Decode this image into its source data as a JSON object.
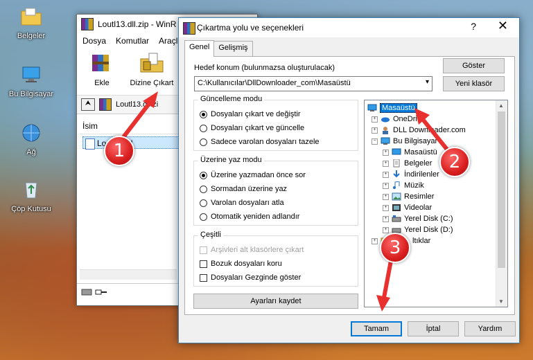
{
  "desktop": {
    "icons": [
      {
        "label": "Belgeler",
        "icon": "folder-icon"
      },
      {
        "label": "Bu Bilgisayar",
        "icon": "computer-icon"
      },
      {
        "label": "Ağ",
        "icon": "network-icon"
      },
      {
        "label": "Çöp Kutusu",
        "icon": "recycle-bin-icon"
      }
    ]
  },
  "winrar": {
    "title": "Loutl13.dll.zip - WinR",
    "menu": [
      "Dosya",
      "Komutlar",
      "Araçla"
    ],
    "toolbar": {
      "add_label": "Ekle",
      "extract_label": "Dizine Çıkart"
    },
    "path": "Loutl13.dll.zi",
    "list_header": "İsim",
    "file_name": "Lo.tl13.dll"
  },
  "dialog": {
    "title": "Çıkartma yolu ve seçenekleri",
    "help": "?",
    "close": "✕",
    "tabs": [
      "Genel",
      "Gelişmiş"
    ],
    "target_label": "Hedef konum (bulunmazsa oluşturulacak)",
    "target_value": "C:\\Kullanıcılar\\DllDownloader_com\\Masaüstü",
    "show_button": "Göster",
    "new_folder_button": "Yeni klasör",
    "update_group": {
      "label": "Güncelleme modu",
      "options": [
        "Dosyaları çıkart ve değiştir",
        "Dosyaları çıkart ve güncelle",
        "Sadece varolan dosyaları tazele"
      ],
      "selected": 0
    },
    "overwrite_group": {
      "label": "Üzerine yaz modu",
      "options": [
        "Üzerine yazmadan önce sor",
        "Sormadan üzerine yaz",
        "Varolan dosyaları atla",
        "Otomatik yeniden adlandır"
      ],
      "selected": 0
    },
    "misc_group": {
      "label": "Çeşitli",
      "options": [
        "Arşivleri alt klasörlere çıkart",
        "Bozuk dosyaları koru",
        "Dosyaları Gezginde göster"
      ]
    },
    "save_settings": "Ayarları kaydet",
    "tree": [
      {
        "label": "Masaüstü",
        "icon": "desktop-icon",
        "selected": true
      },
      {
        "label": "OneDrive",
        "icon": "onedrive-icon"
      },
      {
        "label": "DLL Downloader.com",
        "icon": "user-icon"
      },
      {
        "label": "Bu Bilgisayar",
        "icon": "computer-icon"
      },
      {
        "label": "Masaüstü",
        "icon": "desktop-icon"
      },
      {
        "label": "Belgeler",
        "icon": "documents-icon"
      },
      {
        "label": "İndirilenler",
        "icon": "downloads-icon"
      },
      {
        "label": "Müzik",
        "icon": "music-icon"
      },
      {
        "label": "Resimler",
        "icon": "pictures-icon"
      },
      {
        "label": "Videolar",
        "icon": "videos-icon"
      },
      {
        "label": "Yerel Disk (C:)",
        "icon": "disk-icon"
      },
      {
        "label": "Yerel Disk (D:)",
        "icon": "disk-icon"
      },
      {
        "label": "ltıklar",
        "icon": "folder-icon"
      }
    ],
    "ok_button": "Tamam",
    "cancel_button": "İptal",
    "help_button": "Yardım"
  },
  "markers": [
    "1",
    "2",
    "3"
  ],
  "colors": {
    "marker_red": "#d81e1e",
    "selection_blue": "#0078d7"
  }
}
